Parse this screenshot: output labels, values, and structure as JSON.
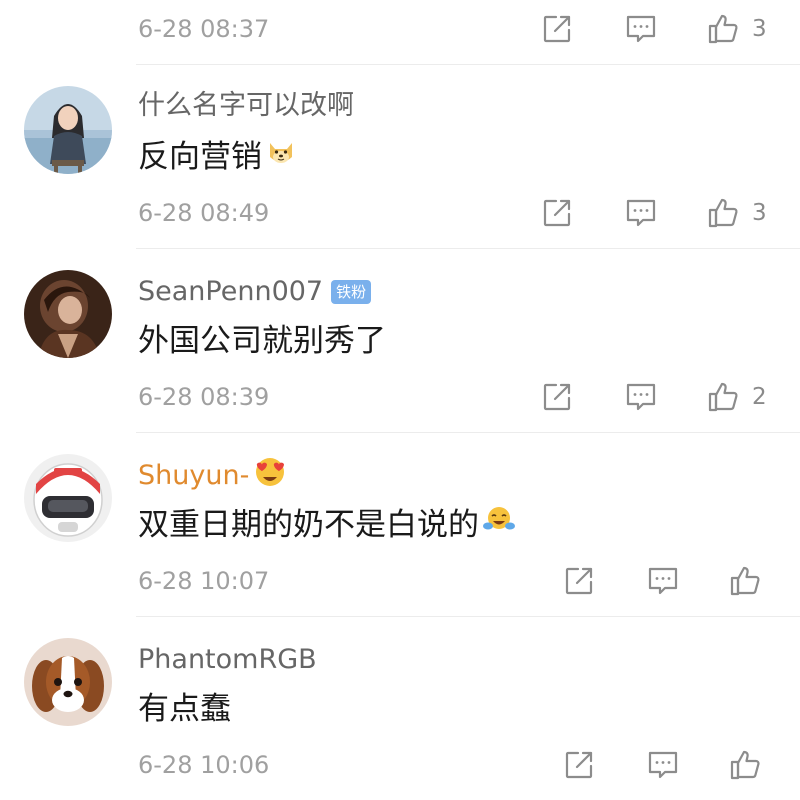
{
  "comments": [
    {
      "username": "",
      "text": "",
      "time": "6-28 08:37",
      "likes": "3",
      "avatar": "none"
    },
    {
      "username": "什么名字可以改啊",
      "text": "反向营销",
      "text_emoji": "doge-emoji",
      "time": "6-28 08:49",
      "likes": "3",
      "avatar": "avatar-girl-sitting"
    },
    {
      "username": "SeanPenn007",
      "badge": "铁粉",
      "text": "外国公司就别秀了",
      "time": "6-28 08:39",
      "likes": "2",
      "avatar": "avatar-dark-portrait"
    },
    {
      "username": "Shuyun-",
      "username_color": "#e08a2e",
      "username_emoji": "heart-eyes-emoji",
      "text": "双重日期的奶不是白说的",
      "text_emoji": "laugh-cry-emoji",
      "time": "6-28 10:07",
      "likes": "",
      "avatar": "avatar-helmet"
    },
    {
      "username": "PhantomRGB",
      "text": "有点蠢",
      "time": "6-28 10:06",
      "likes": "",
      "avatar": "avatar-dog"
    }
  ],
  "icons": {
    "repost": "repost-icon",
    "comment": "comment-icon",
    "like": "thumbs-up-icon"
  },
  "colors": {
    "username": "#666666",
    "username_highlight": "#e08a2e",
    "text": "#1a1a1a",
    "meta": "#a0a0a0",
    "badge": "#7ab0ec",
    "icon": "#8c8c8c"
  }
}
